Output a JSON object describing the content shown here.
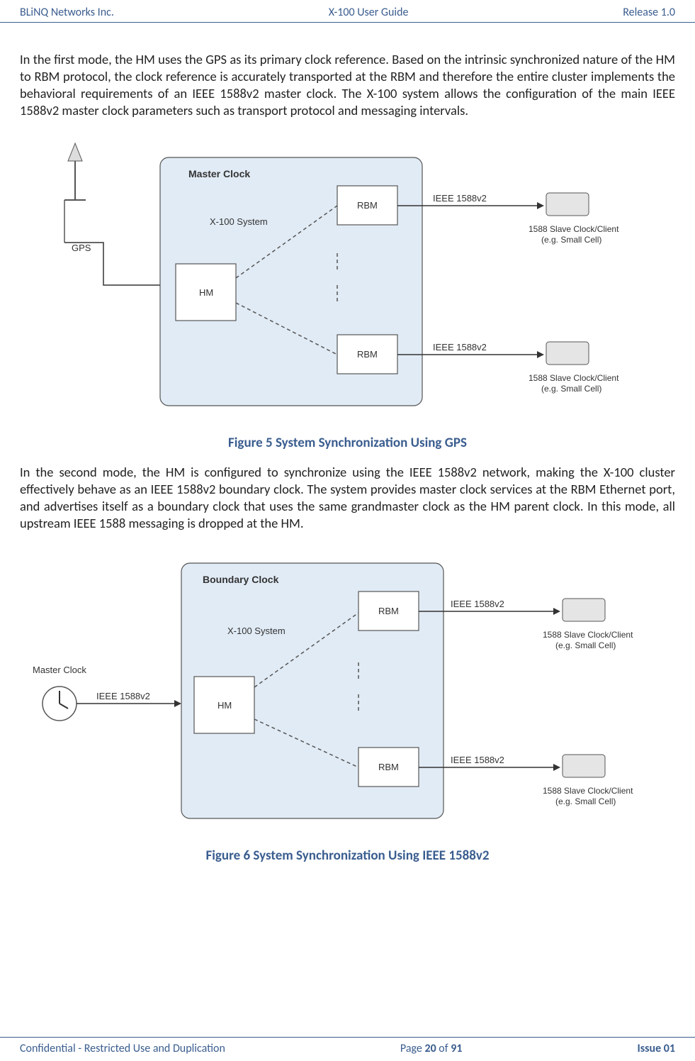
{
  "header": {
    "left": "BLiNQ Networks Inc.",
    "center": "X-100 User Guide",
    "right": "Release 1.0"
  },
  "para1": "In the first mode, the HM uses the GPS as its primary clock reference. Based on the intrinsic synchronized nature of the HM to RBM protocol, the clock reference is accurately transported at the RBM and therefore the entire cluster implements the behavioral requirements of an IEEE 1588v2 master clock. The X-100 system allows the configuration of the main IEEE 1588v2 master clock parameters such as transport protocol and messaging intervals.",
  "fig5": {
    "title": "Master Clock",
    "system_lbl": "X-100 System",
    "hm": "HM",
    "rbm": "RBM",
    "gps": "GPS",
    "ieee": "IEEE 1588v2",
    "client1": "1588 Slave Clock/Client",
    "client2": "(e.g. Small Cell)",
    "caption": "Figure 5 System Synchronization Using GPS"
  },
  "para2": "In the second mode, the HM is configured to synchronize using the IEEE 1588v2 network, making the X-100 cluster effectively behave as an IEEE 1588v2 boundary clock. The system provides master clock services at the RBM Ethernet port, and advertises itself as a boundary clock that uses the same grandmaster clock as the HM parent clock. In this mode, all upstream IEEE 1588 messaging is dropped at the HM.",
  "fig6": {
    "title": "Boundary Clock",
    "system_lbl": "X-100 System",
    "hm": "HM",
    "rbm": "RBM",
    "master": "Master Clock",
    "ieee": "IEEE 1588v2",
    "client1": "1588 Slave Clock/Client",
    "client2": "(e.g. Small Cell)",
    "caption": "Figure 6 System Synchronization Using IEEE 1588v2"
  },
  "footer": {
    "left": "Confidential - Restricted Use and Duplication",
    "page_pre": "Page ",
    "page_num": "20",
    "page_mid": " of ",
    "page_total": "91",
    "right": "Issue 01"
  }
}
